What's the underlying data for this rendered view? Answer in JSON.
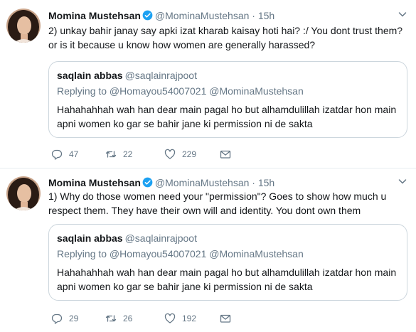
{
  "tweets": [
    {
      "author_name": "Momina Mustehsan",
      "author_handle": "@MominaMustehsan",
      "separator": "·",
      "time": "15h",
      "text": "2) unkay bahir janay say apki izat kharab kaisay hoti hai? :/ You dont trust them? or is it because u know how women are generally harassed?",
      "quote": {
        "name": "saqlain abbas",
        "handle": "@saqlainrajpoot",
        "replying_to": "Replying to @Homayou54007021 @MominaMustehsan",
        "text": "Hahahahhah wah han dear main pagal ho but alhamdulillah izatdar hon main apni women ko gar se bahir jane ki permission ni de sakta"
      },
      "counts": {
        "replies": "47",
        "retweets": "22",
        "likes": "229"
      }
    },
    {
      "author_name": "Momina Mustehsan",
      "author_handle": "@MominaMustehsan",
      "separator": "·",
      "time": "15h",
      "text": "1) Why do those women need your \"permission\"? Goes to show how much u respect them. They have their own will and identity. You dont own them",
      "quote": {
        "name": "saqlain abbas",
        "handle": "@saqlainrajpoot",
        "replying_to": "Replying to @Homayou54007021 @MominaMustehsan",
        "text": "Hahahahhah wah han dear main pagal ho but alhamdulillah izatdar hon main apni women ko gar se bahir jane ki permission ni de sakta"
      },
      "counts": {
        "replies": "29",
        "retweets": "26",
        "likes": "192"
      }
    }
  ],
  "icons": {
    "verified": "verified-badge-icon",
    "menu": "chevron-down-icon",
    "reply": "reply-icon",
    "retweet": "retweet-icon",
    "like": "heart-icon",
    "dm": "envelope-icon"
  },
  "colors": {
    "verified_blue": "#1da1f2",
    "text": "#14171a",
    "secondary": "#657786",
    "border": "#e6ecf0",
    "quote_border": "#ccd6dd"
  }
}
